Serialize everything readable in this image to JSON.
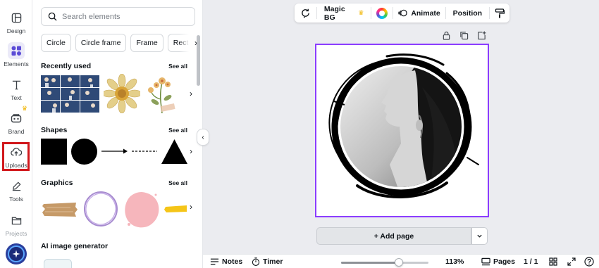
{
  "rail": {
    "items": [
      {
        "label": "Design",
        "icon": "design-icon"
      },
      {
        "label": "Elements",
        "icon": "elements-icon"
      },
      {
        "label": "Text",
        "icon": "text-icon"
      },
      {
        "label": "Brand",
        "icon": "brand-icon"
      },
      {
        "label": "Uploads",
        "icon": "upload-cloud-icon"
      },
      {
        "label": "Tools",
        "icon": "tools-icon"
      },
      {
        "label": "Projects",
        "icon": "folder-icon"
      }
    ],
    "active": "Elements",
    "highlighted": "Uploads",
    "highlight_color": "#d1171b",
    "accent": "#8b3dff"
  },
  "panel": {
    "search_placeholder": "Search elements",
    "chips": [
      "Circle",
      "Circle frame",
      "Frame",
      "Rectangle"
    ],
    "sections": {
      "recent": {
        "title": "Recently used",
        "see_all": "See all"
      },
      "shapes": {
        "title": "Shapes",
        "see_all": "See all"
      },
      "graphics": {
        "title": "Graphics",
        "see_all": "See all"
      },
      "ai": {
        "title": "AI image generator"
      }
    }
  },
  "toolbar": {
    "magic_bg": "Magic BG",
    "animate": "Animate",
    "position": "Position"
  },
  "canvas": {
    "add_page": "+ Add page"
  },
  "bottombar": {
    "notes": "Notes",
    "timer": "Timer",
    "zoom": "113%",
    "zoom_level": 0.66,
    "pages": "Pages",
    "page_count": "1 / 1"
  }
}
